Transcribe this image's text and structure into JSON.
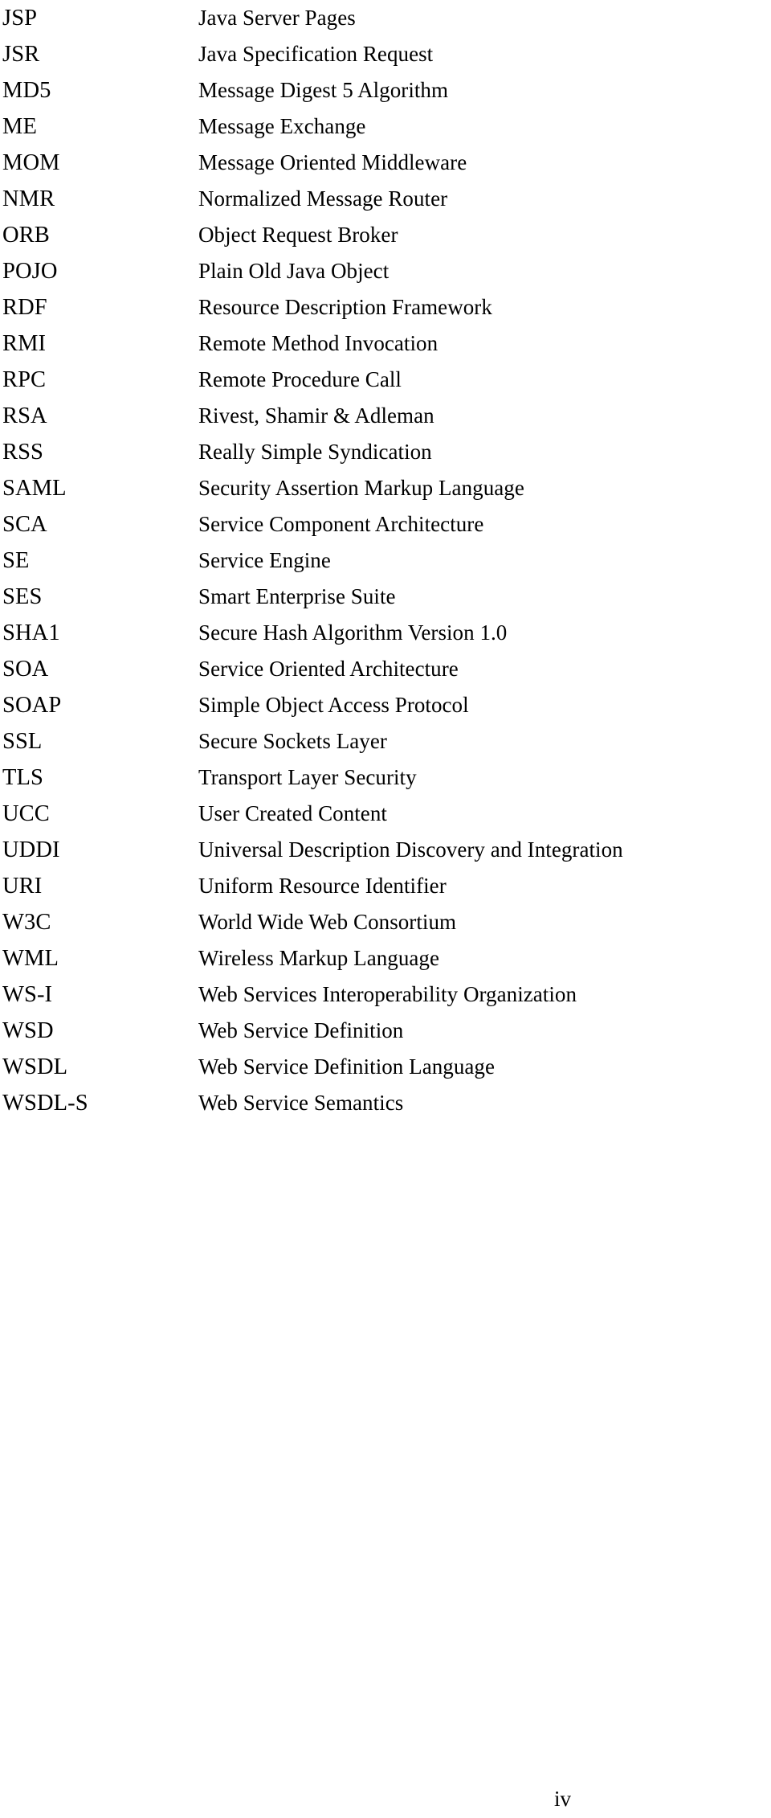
{
  "document": {
    "type": "abbreviations-glossary",
    "page_number": "iv",
    "entries": [
      {
        "abbr": "JSP",
        "expansion": "Java Server Pages"
      },
      {
        "abbr": "JSR",
        "expansion": "Java Specification Request"
      },
      {
        "abbr": "MD5",
        "expansion": "Message Digest 5 Algorithm"
      },
      {
        "abbr": "ME",
        "expansion": "Message Exchange"
      },
      {
        "abbr": "MOM",
        "expansion": "Message Oriented Middleware"
      },
      {
        "abbr": "NMR",
        "expansion": "Normalized Message Router"
      },
      {
        "abbr": "ORB",
        "expansion": "Object Request Broker"
      },
      {
        "abbr": "POJO",
        "expansion": "Plain Old Java Object"
      },
      {
        "abbr": "RDF",
        "expansion": "Resource Description Framework"
      },
      {
        "abbr": "RMI",
        "expansion": "Remote Method Invocation"
      },
      {
        "abbr": "RPC",
        "expansion": "Remote Procedure Call"
      },
      {
        "abbr": "RSA",
        "expansion": "Rivest, Shamir & Adleman"
      },
      {
        "abbr": "RSS",
        "expansion": "Really Simple Syndication"
      },
      {
        "abbr": "SAML",
        "expansion": "Security Assertion Markup Language"
      },
      {
        "abbr": "SCA",
        "expansion": "Service Component Architecture"
      },
      {
        "abbr": "SE",
        "expansion": "Service Engine"
      },
      {
        "abbr": "SES",
        "expansion": "Smart Enterprise Suite"
      },
      {
        "abbr": "SHA1",
        "expansion": "Secure Hash Algorithm Version 1.0"
      },
      {
        "abbr": "SOA",
        "expansion": "Service Oriented Architecture"
      },
      {
        "abbr": "SOAP",
        "expansion": "Simple Object Access Protocol"
      },
      {
        "abbr": "SSL",
        "expansion": "Secure Sockets Layer"
      },
      {
        "abbr": "TLS",
        "expansion": "Transport Layer Security"
      },
      {
        "abbr": "UCC",
        "expansion": "User Created Content"
      },
      {
        "abbr": "UDDI",
        "expansion": "Universal Description Discovery and Integration"
      },
      {
        "abbr": "URI",
        "expansion": "Uniform Resource Identifier"
      },
      {
        "abbr": "W3C",
        "expansion": "World Wide Web Consortium"
      },
      {
        "abbr": "WML",
        "expansion": "Wireless Markup Language"
      },
      {
        "abbr": "WS-I",
        "expansion": "Web Services Interoperability Organization"
      },
      {
        "abbr": "WSD",
        "expansion": "Web Service Definition"
      },
      {
        "abbr": "WSDL",
        "expansion": "Web Service Definition Language"
      },
      {
        "abbr": "WSDL-S",
        "expansion": "Web Service Semantics"
      }
    ]
  }
}
